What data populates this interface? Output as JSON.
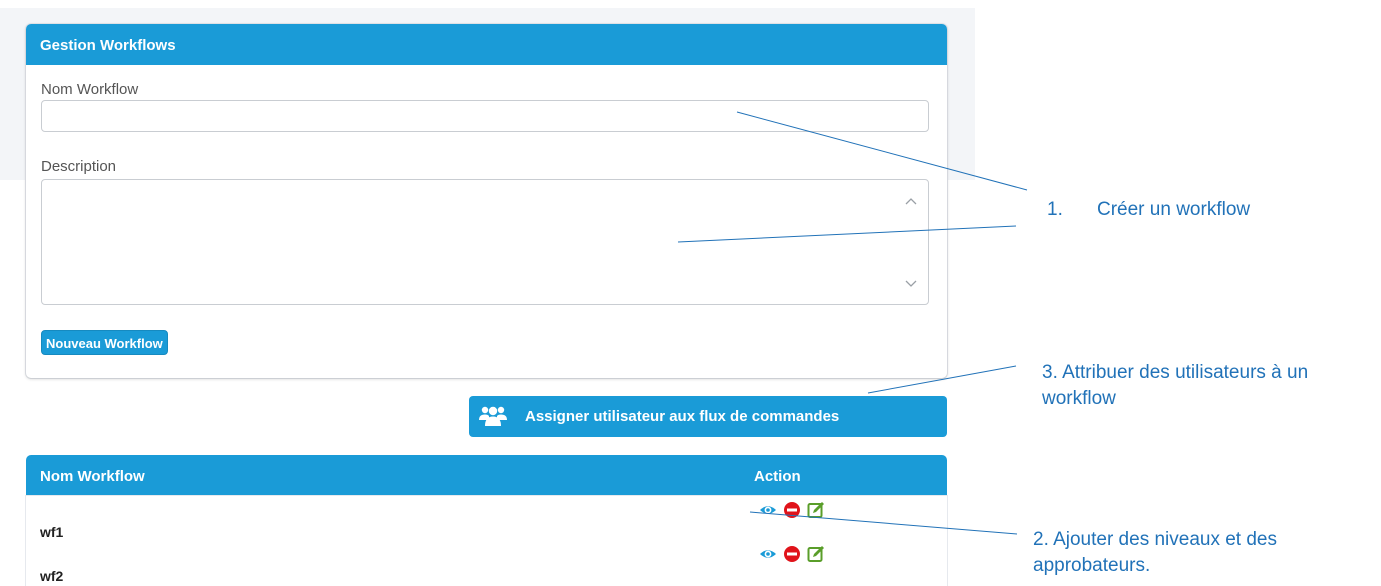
{
  "panel": {
    "title": "Gestion Workflows",
    "name_label": "Nom Workflow",
    "name_value": "",
    "description_label": "Description",
    "description_value": "",
    "new_button_label": "Nouveau Workflow"
  },
  "assign_button": {
    "label": "Assigner utilisateur aux flux de commandes",
    "icon": "users-icon"
  },
  "table": {
    "columns": [
      "Nom Workflow",
      "Action"
    ],
    "rows": [
      {
        "name": "wf1",
        "actions": [
          "eye-icon",
          "minus-circle-icon",
          "edit-icon"
        ]
      },
      {
        "name": "wf2",
        "actions": [
          "eye-icon",
          "minus-circle-icon",
          "edit-icon"
        ]
      }
    ]
  },
  "annotations": [
    {
      "number": "1.",
      "text": "Créer un workflow"
    },
    {
      "text": "3. Attribuer des utilisateurs à un workflow"
    },
    {
      "text": "2. Ajouter des niveaux et des approbateurs."
    }
  ],
  "colors": {
    "primary": "#1a9bd7",
    "annotation": "#2172b8",
    "view_icon": "#1a9bd7",
    "delete_icon": "#e0131a",
    "edit_icon": "#5a9e2a"
  }
}
